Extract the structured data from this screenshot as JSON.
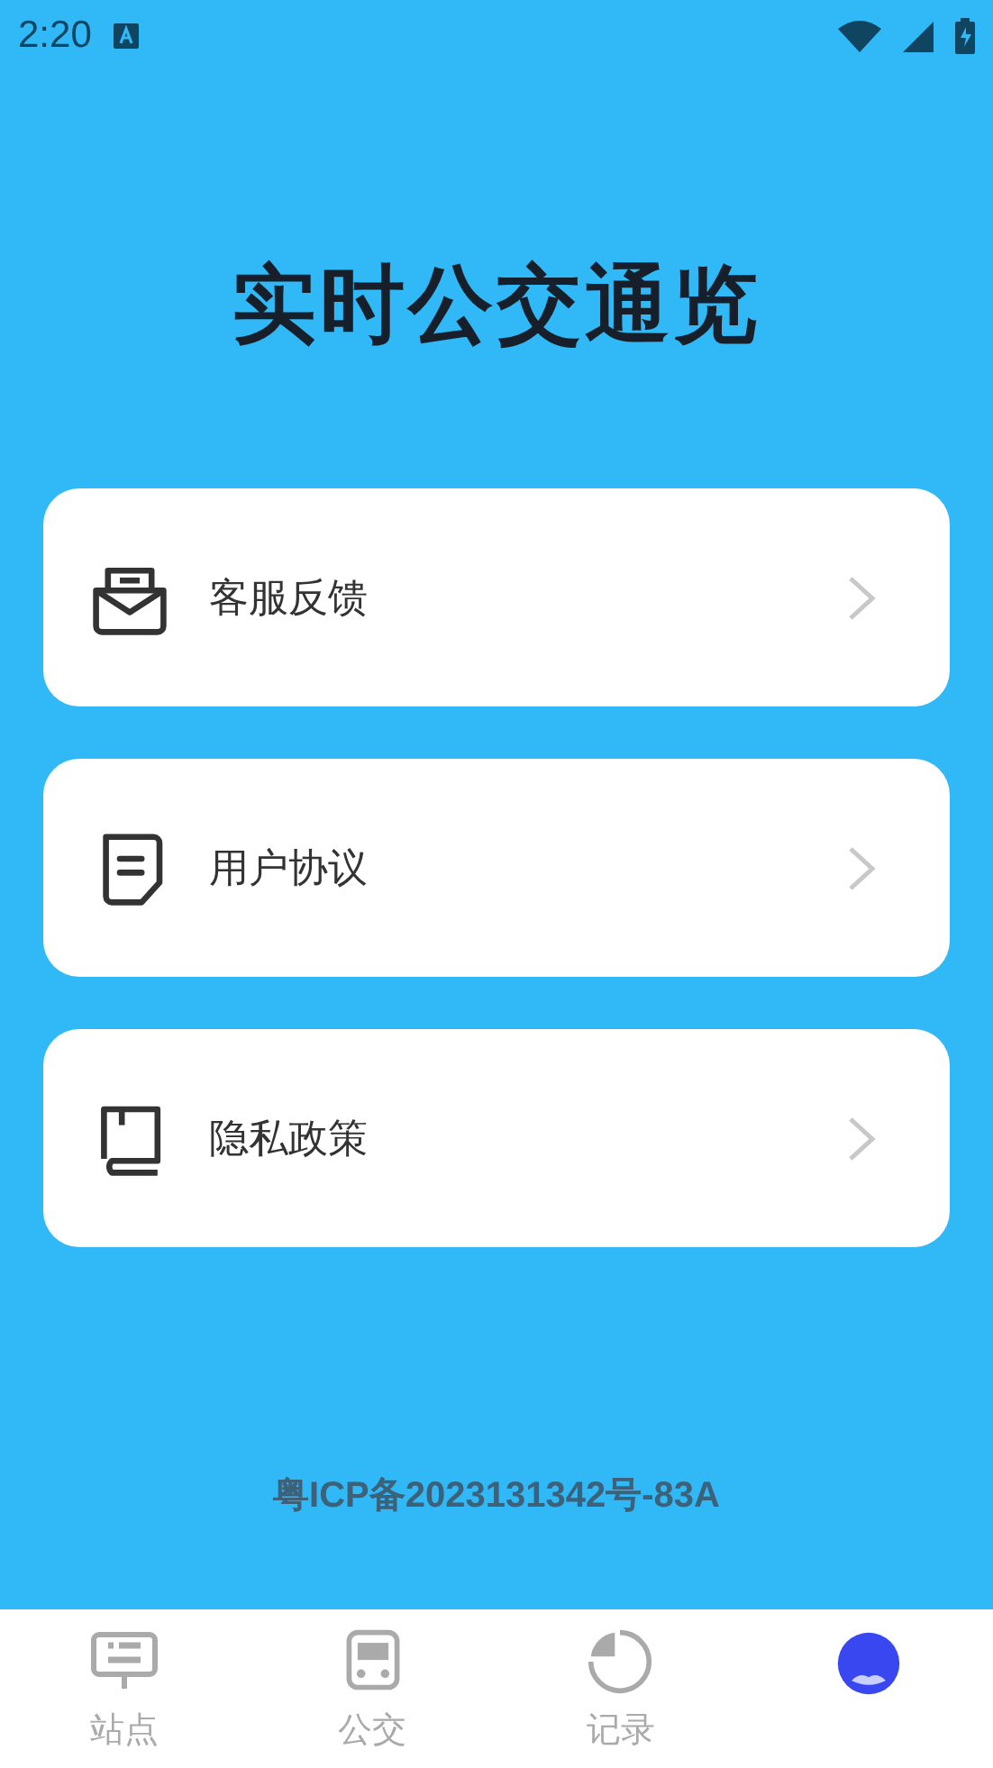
{
  "status_bar": {
    "time": "2:20"
  },
  "title": "实时公交通览",
  "menu": [
    {
      "kind": "feedback",
      "label": "客服反馈"
    },
    {
      "kind": "agreement",
      "label": "用户协议"
    },
    {
      "kind": "privacy",
      "label": "隐私政策"
    }
  ],
  "icp": "粤ICP备2023131342号-83A",
  "nav": [
    {
      "kind": "stops",
      "label": "站点",
      "selected": false
    },
    {
      "kind": "bus",
      "label": "公交",
      "selected": false
    },
    {
      "kind": "history",
      "label": "记录",
      "selected": false
    },
    {
      "kind": "profile",
      "selected": true
    }
  ]
}
